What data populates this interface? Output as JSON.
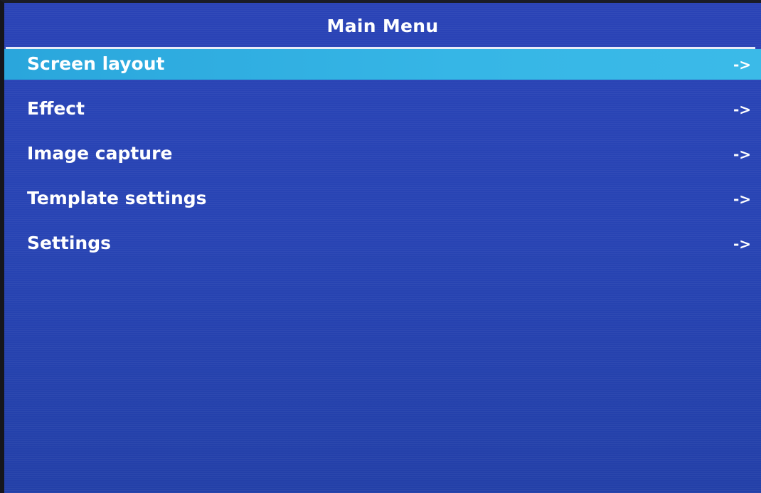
{
  "header": {
    "title": "Main Menu"
  },
  "menu": {
    "items": [
      {
        "label": "Screen layout",
        "arrow": "->",
        "selected": true
      },
      {
        "label": "Effect",
        "arrow": "->",
        "selected": false
      },
      {
        "label": "Image capture",
        "arrow": "->",
        "selected": false
      },
      {
        "label": "Template settings",
        "arrow": "->",
        "selected": false
      },
      {
        "label": "Settings",
        "arrow": "->",
        "selected": false
      }
    ]
  },
  "colors": {
    "background": "#2844b4",
    "highlight": "#36b6e6",
    "text": "#ffffff",
    "divider": "#e8ecf8"
  }
}
